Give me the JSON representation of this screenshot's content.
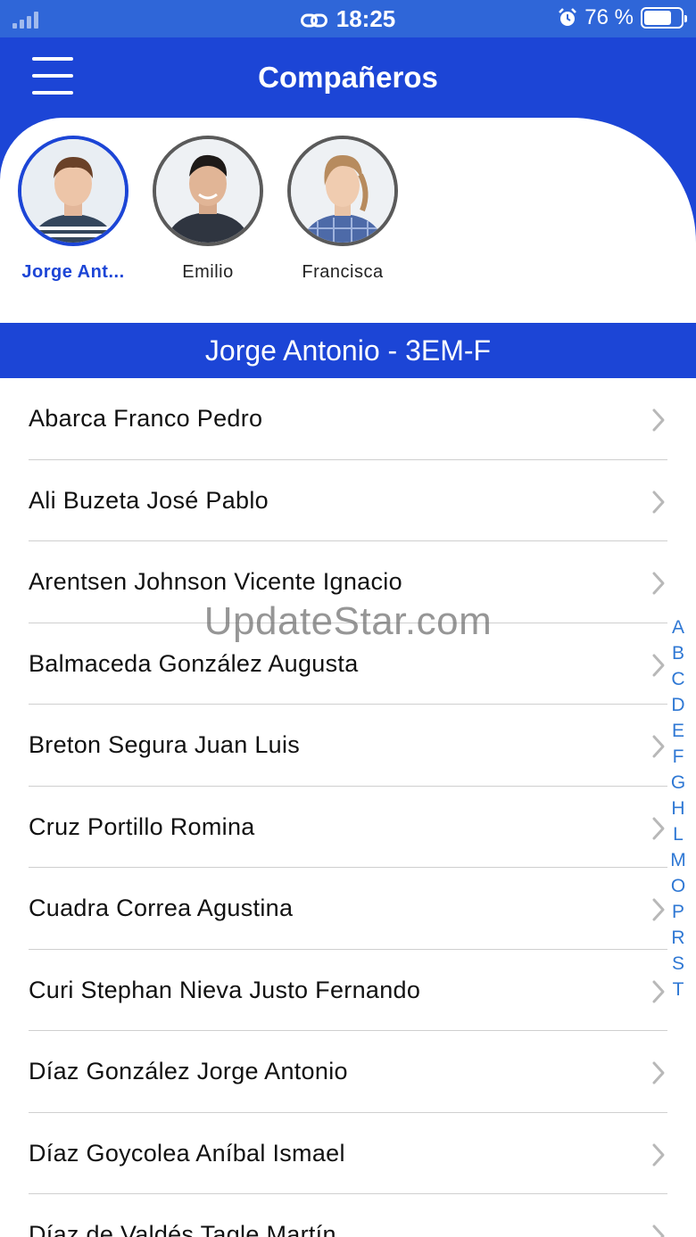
{
  "status_bar": {
    "time": "18:25",
    "battery_text": "76 %",
    "battery_level_percent": 76
  },
  "header": {
    "title": "Compañeros"
  },
  "students": [
    {
      "name": "Jorge Ant...",
      "selected": true
    },
    {
      "name": "Emilio",
      "selected": false
    },
    {
      "name": "Francisca",
      "selected": false
    }
  ],
  "selected_bar": {
    "text": "Jorge Antonio - 3EM-F"
  },
  "classmates": [
    "Abarca Franco Pedro",
    "Ali Buzeta José Pablo",
    "Arentsen Johnson Vicente Ignacio",
    "Balmaceda González Augusta",
    "Breton Segura Juan Luis",
    "Cruz Portillo Romina",
    "Cuadra Correa Agustina",
    "Curi Stephan Nieva Justo Fernando",
    "Díaz González Jorge Antonio",
    "Díaz Goycolea Aníbal Ismael",
    "Díaz de Valdés Tagle Martín"
  ],
  "alpha_index": [
    "A",
    "B",
    "C",
    "D",
    "E",
    "F",
    "G",
    "H",
    "L",
    "M",
    "O",
    "P",
    "R",
    "S",
    "T"
  ],
  "watermark": "UpdateStar.com",
  "colors": {
    "primary": "#1c45d6",
    "status_bar": "#2f66d8",
    "index_text": "#2f78d4"
  }
}
